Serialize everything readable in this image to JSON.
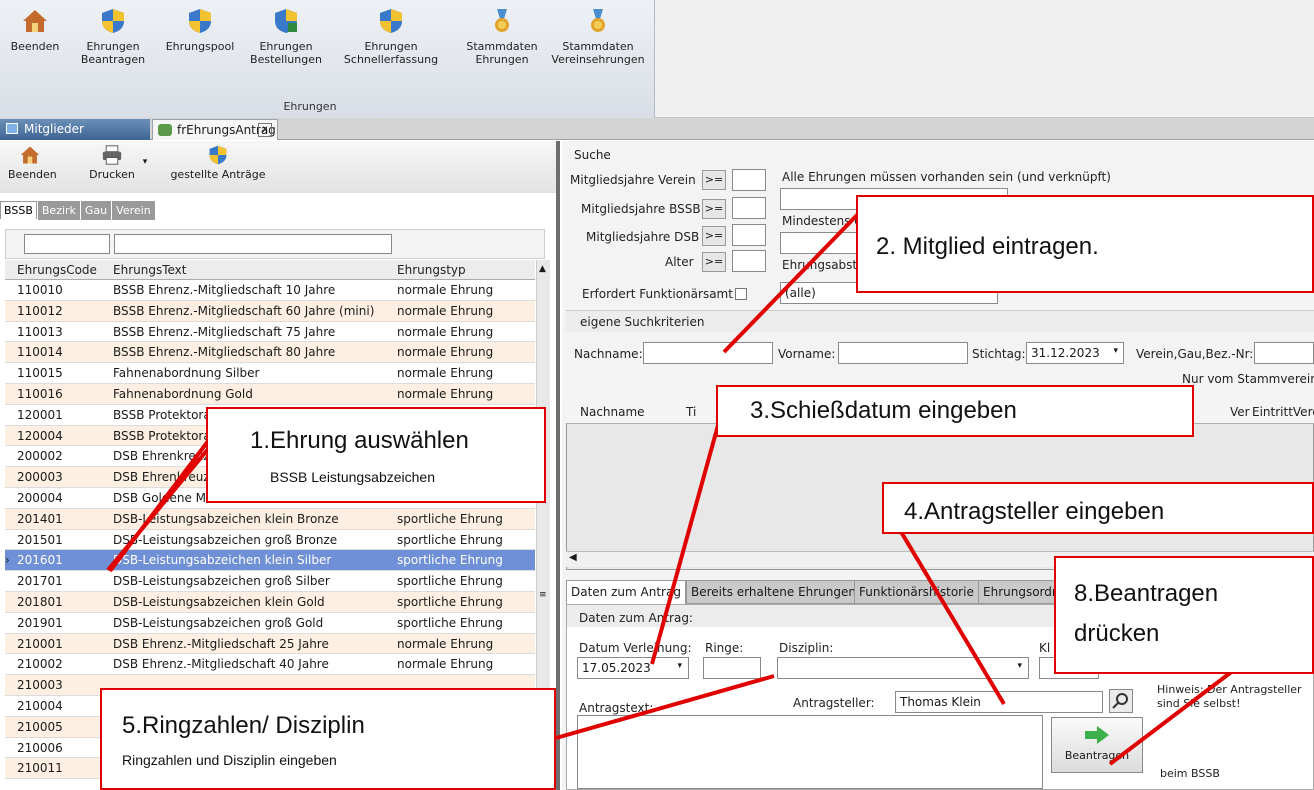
{
  "ribbon": {
    "buttons": [
      {
        "label": "Beenden",
        "icon": "house-icon"
      },
      {
        "label": "Ehrungen\nBeantragen",
        "icon": "shield-a-icon"
      },
      {
        "label": "Ehrungspool",
        "icon": "shield-icon"
      },
      {
        "label": "Ehrungen\nBestellungen",
        "icon": "shield-b-icon"
      },
      {
        "label": "Ehrungen\nSchnellerfassung",
        "icon": "shield-star-icon"
      },
      {
        "label": "Stammdaten\nEhrungen",
        "icon": "medal-icon"
      },
      {
        "label": "Stammdaten\nVereinsehrungen",
        "icon": "medal-icon"
      }
    ],
    "group_label": "Ehrungen"
  },
  "doc_tabs": [
    {
      "label": "Mitglieder"
    },
    {
      "label": "frEhrungsAntrag",
      "close": "x"
    }
  ],
  "left_toolbar": {
    "beenden": "Beenden",
    "drucken": "Drucken",
    "gestellte": "gestellte Anträge"
  },
  "levels": [
    "BSSB",
    "Bezirk",
    "Gau",
    "Verein"
  ],
  "grid": {
    "headers": [
      "EhrungsCode",
      "EhrungsText",
      "Ehrungstyp"
    ],
    "rows": [
      [
        "110010",
        "BSSB Ehrenz.-Mitgliedschaft 10 Jahre",
        "normale Ehrung"
      ],
      [
        "110012",
        "BSSB Ehrenz.-Mitgliedschaft 60 Jahre (mini)",
        "normale Ehrung"
      ],
      [
        "110013",
        "BSSB Ehrenz.-Mitgliedschaft 75 Jahre",
        "normale Ehrung"
      ],
      [
        "110014",
        "BSSB Ehrenz.-Mitgliedschaft 80 Jahre",
        "normale Ehrung"
      ],
      [
        "110015",
        "Fahnenabordnung Silber",
        "normale Ehrung"
      ],
      [
        "110016",
        "Fahnenabordnung Gold",
        "normale Ehrung"
      ],
      [
        "120001",
        "BSSB Protektora",
        ""
      ],
      [
        "120004",
        "BSSB Protektora",
        ""
      ],
      [
        "200002",
        "DSB Ehrenkreuz",
        ""
      ],
      [
        "200003",
        "DSB Ehrenkreuz",
        ""
      ],
      [
        "200004",
        "DSB Goldene Me",
        ""
      ],
      [
        "201401",
        "DSB-Leistungsabzeichen klein Bronze",
        "sportliche Ehrung"
      ],
      [
        "201501",
        "DSB-Leistungsabzeichen groß Bronze",
        "sportliche Ehrung"
      ],
      [
        "201601",
        "DSB-Leistungsabzeichen klein Silber",
        "sportliche Ehrung"
      ],
      [
        "201701",
        "DSB-Leistungsabzeichen groß Silber",
        "sportliche Ehrung"
      ],
      [
        "201801",
        "DSB-Leistungsabzeichen klein Gold",
        "sportliche Ehrung"
      ],
      [
        "201901",
        "DSB-Leistungsabzeichen groß Gold",
        "sportliche Ehrung"
      ],
      [
        "210001",
        "DSB Ehrenz.-Mitgliedschaft 25 Jahre",
        "normale Ehrung"
      ],
      [
        "210002",
        "DSB Ehrenz.-Mitgliedschaft 40 Jahre",
        "normale Ehrung"
      ],
      [
        "210003",
        "",
        ""
      ],
      [
        "210004",
        "",
        ""
      ],
      [
        "210005",
        "",
        ""
      ],
      [
        "210006",
        "",
        ""
      ],
      [
        "210011",
        "",
        ""
      ]
    ],
    "selected_index": 13
  },
  "search": {
    "title": "Suche",
    "mj_verein": "Mitgliedsjahre Verein",
    "mj_bssb": "Mitgliedsjahre BSSB",
    "mj_dsb": "Mitgliedsjahre DSB",
    "alter": "Alter",
    "op": ">=",
    "alle_ehrungen": "Alle Ehrungen müssen vorhanden sein (und verknüpft)",
    "mindestens": "Mindestens e",
    "ehrungsabst": "Ehrungsabst",
    "erfordert": "Erfordert Funktionärsamt",
    "alle_value": "(alle)"
  },
  "own_criteria": {
    "title": "eigene Suchkriterien",
    "nachname": "Nachname:",
    "vorname": "Vorname:",
    "stichtag": "Stichtag:",
    "stichtag_value": "31.12.2023",
    "verein": "Verein,Gau,Bez.-Nr:",
    "nur_stamm": "Nur vom Stammverein"
  },
  "result_grid": {
    "headers": [
      "Nachname",
      "Ti",
      "Ver",
      "EintrittVere"
    ]
  },
  "antrag_tabs": [
    "Daten zum Antrag",
    "Bereits erhaltene Ehrungen",
    "Funktionärshistorie",
    "Ehrungsordn"
  ],
  "antrag": {
    "section": "Daten zum Antrag:",
    "datum_label": "Datum Verleihung:",
    "datum_value": "17.05.2023",
    "ringe_label": "Ringe:",
    "disziplin_label": "Disziplin:",
    "kl_label": "Kl",
    "antragsteller_label": "Antragsteller:",
    "antragsteller_value": "Thomas Klein",
    "antragstext_label": "Antragstext:",
    "hinweis": "Hinweis: Der Antragsteller sind Sie selbst!",
    "beantragen": "Beantragen",
    "beim": "beim BSSB"
  },
  "callouts": {
    "c1_title": "1.Ehrung auswählen",
    "c1_sub": "BSSB Leistungsabzeichen",
    "c2_title": "2. Mitglied eintragen.",
    "c3_title": "3.Schießdatum eingeben",
    "c4_title": "4.Antragsteller eingeben",
    "c5_title": "5.Ringzahlen/ Disziplin",
    "c5_sub": "Ringzahlen und Disziplin eingeben",
    "c8_line1": "8.Beantragen",
    "c8_line2": "drücken"
  },
  "colors": {
    "accent_red": "#e00000",
    "selection": "#6f8fd6",
    "row_alt": "#fdf0e2"
  }
}
